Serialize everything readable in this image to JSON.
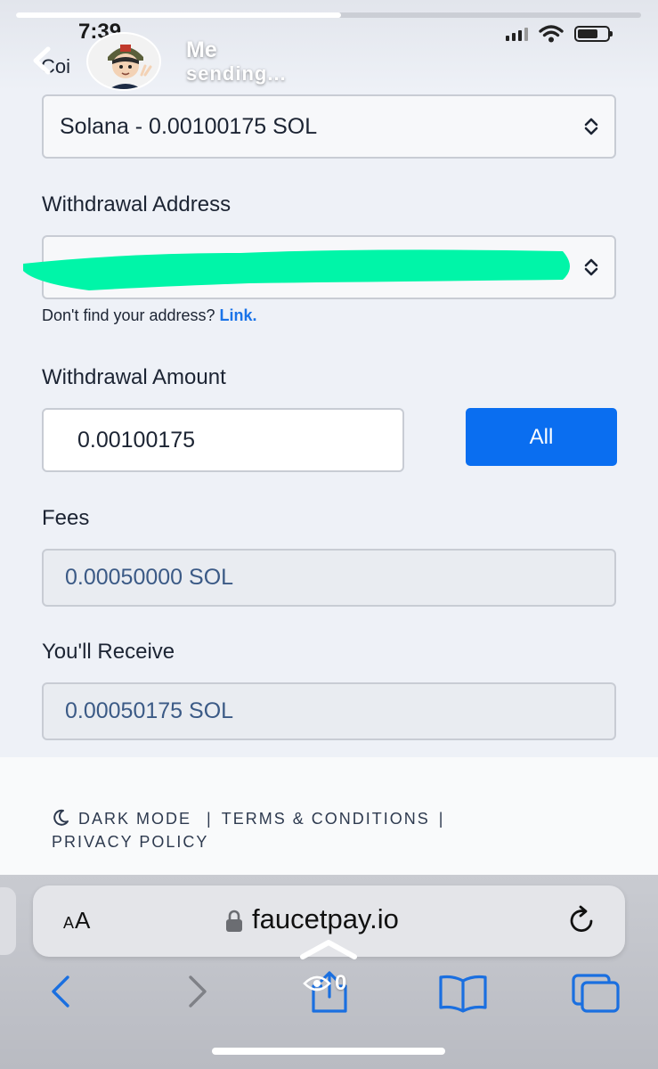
{
  "story": {
    "progress_fraction": 0.52,
    "user_name": "Me",
    "status_text": "sending...",
    "viewer_count": "0"
  },
  "status_bar": {
    "time": "7:39"
  },
  "coin": {
    "label_partial": "Coi",
    "selected": "Solana - 0.00100175 SOL"
  },
  "withdrawal_address": {
    "label": "Withdrawal Address",
    "helper_text": "Don't find your address? ",
    "helper_link": "Link.",
    "redaction_color": "#00f5a8"
  },
  "withdrawal_amount": {
    "label": "Withdrawal Amount",
    "value": "0.00100175",
    "all_button": "All"
  },
  "fees": {
    "label": "Fees",
    "value": "0.00050000 SOL"
  },
  "receive": {
    "label": "You'll Receive",
    "value": "0.00050175 SOL"
  },
  "footer": {
    "dark_mode": "DARK MODE",
    "terms": "TERMS & CONDITIONS",
    "privacy": "PRIVACY POLICY"
  },
  "browser": {
    "text_size_label_big": "A",
    "text_size_label_small": "A",
    "url": "faucetpay.io"
  },
  "colors": {
    "accent": "#0a6ef0",
    "link": "#1a73e8",
    "readonly_text": "#3b5a86"
  }
}
